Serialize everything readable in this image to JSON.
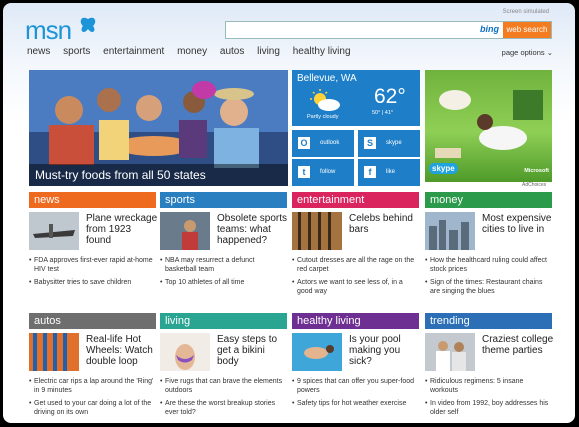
{
  "header": {
    "logo": "msn",
    "simulated": "Screen simulated",
    "bing_label": "bing",
    "search_button": "web search",
    "page_options": "page options ⌄"
  },
  "nav": [
    "news",
    "sports",
    "entertainment",
    "money",
    "autos",
    "living",
    "healthy living"
  ],
  "hero": {
    "caption": "Must-try foods from all 50 states"
  },
  "weather": {
    "city": "Bellevue, WA",
    "temp": "62°",
    "condition": "Partly cloudy",
    "range": "50° | 41°"
  },
  "tiles": [
    {
      "icon": "O",
      "label": "outlook"
    },
    {
      "icon": "S",
      "label": "skype"
    },
    {
      "icon": "t",
      "label": "follow"
    },
    {
      "icon": "f",
      "label": "like"
    }
  ],
  "ad": {
    "brand": "skype",
    "sponsor": "Microsoft",
    "adchoices": "AdChoices"
  },
  "colors": {
    "news": "#ee6a1f",
    "sports": "#2a7fc0",
    "entertainment": "#d9245e",
    "money": "#2b9a4a",
    "autos": "#6e6e6e",
    "living": "#2aa592",
    "healthy": "#6d2f92",
    "trending": "#2c6fb7"
  },
  "sections": [
    {
      "header": "news",
      "title": "Plane wreckage from 1923 found",
      "bullets": [
        "FDA approves first-ever rapid at-home HIV test",
        "Babysitter tries to save children"
      ]
    },
    {
      "header": "sports",
      "title": "Obsolete sports teams: what happened?",
      "bullets": [
        "NBA may resurrect a defunct basketball team",
        "Top 10 athletes of all time"
      ]
    },
    {
      "header": "entertainment",
      "title": "Celebs behind bars",
      "bullets": [
        "Cutout dresses are all the rage on the red carpet",
        "Actors we want to see less of, in a good way"
      ]
    },
    {
      "header": "money",
      "title": "Most expensive cities to live in",
      "bullets": [
        "How the healthcard ruling could affect stock prices",
        "Sign of the times: Restaurant chains are singing the blues"
      ]
    },
    {
      "header": "autos",
      "title": "Real-life Hot Wheels: Watch double loop",
      "bullets": [
        "Electric car rips a lap around the 'Ring' in 9 minutes",
        "Get used to your car doing a lot of the driving on its own"
      ]
    },
    {
      "header": "living",
      "title": "Easy steps to get a bikini body",
      "bullets": [
        "Five rugs that can brave the elements outdoors",
        "Are these the worst breakup stories ever told?"
      ]
    },
    {
      "header": "healthy living",
      "title": "Is your pool making you sick?",
      "bullets": [
        "9 spices that can offer you super-food powers",
        "Safety tips for hot weather exercise"
      ]
    },
    {
      "header": "trending",
      "title": "Craziest college theme parties",
      "bullets": [
        "Ridiculous regimens: 5 insane workouts",
        "In video from 1992, boy addresses his older self"
      ]
    }
  ]
}
